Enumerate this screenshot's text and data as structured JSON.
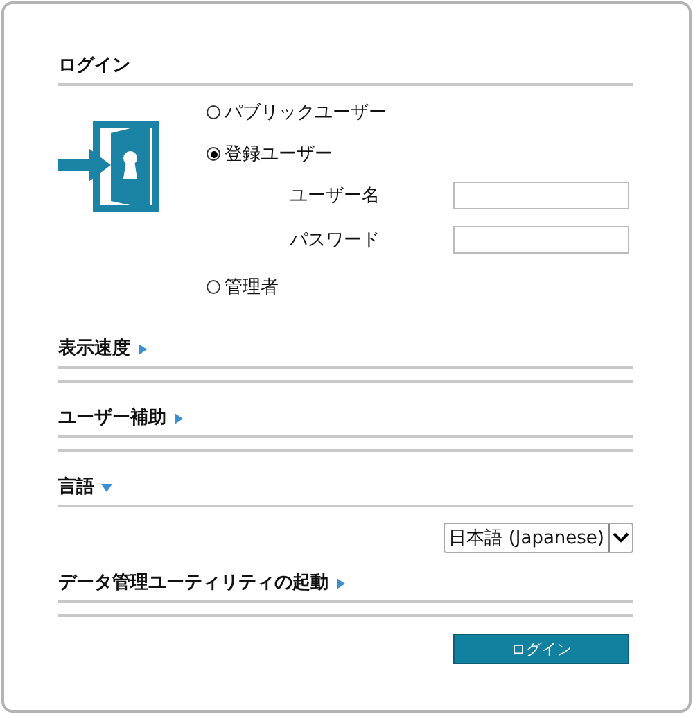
{
  "login": {
    "title": "ログイン",
    "user_types": [
      {
        "label": "パブリックユーザー",
        "selected": false
      },
      {
        "label": "登録ユーザー",
        "selected": true
      },
      {
        "label": "管理者",
        "selected": false
      }
    ],
    "fields": [
      {
        "label": "ユーザー名"
      },
      {
        "label": "パスワード"
      }
    ]
  },
  "sections": [
    {
      "title": "表示速度",
      "expanded": false
    },
    {
      "title": "ユーザー補助",
      "expanded": false
    },
    {
      "title": "言語",
      "expanded": true,
      "select": "日本語 (Japanese)"
    },
    {
      "title": "データ管理ユーティリティの起動",
      "expanded": false
    }
  ],
  "login_button": "ログイン"
}
